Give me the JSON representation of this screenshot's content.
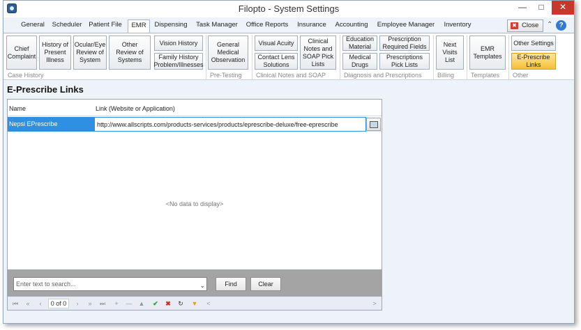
{
  "window": {
    "title": "Filopto - System Settings"
  },
  "tabs": [
    {
      "label": "General"
    },
    {
      "label": "Scheduler"
    },
    {
      "label": "Patient File"
    },
    {
      "label": "EMR"
    },
    {
      "label": "Dispensing"
    },
    {
      "label": "Task Manager"
    },
    {
      "label": "Office Reports"
    },
    {
      "label": "Insurance"
    },
    {
      "label": "Accounting"
    },
    {
      "label": "Employee Manager"
    },
    {
      "label": "Inventory"
    }
  ],
  "active_tab": "EMR",
  "close_button": {
    "label": "Close"
  },
  "ribbon": {
    "case_history": {
      "label": "Case History",
      "buttons": [
        "Chief Complaint",
        "History of Present Illness",
        "Ocular/Eye Review of System",
        "Other Review of Systems",
        "Vision History",
        "Family History Problem/Illnesses"
      ]
    },
    "pre_testing": {
      "label": "Pre-Testing",
      "buttons": [
        "General Medical Observation"
      ]
    },
    "clinical_notes": {
      "label": "Clinical Notes and SOAP",
      "buttons": [
        "Visual Acuity",
        "Contact Lens Solutions",
        "Clinical Notes and SOAP Pick Lists"
      ]
    },
    "diagnosis": {
      "label": "Diagnosis and Prescriptions",
      "buttons": [
        "Education Material",
        "Medical Drugs",
        "Prescription Required Fields",
        "Prescriptions Pick Lists"
      ]
    },
    "billing": {
      "label": "Billing",
      "buttons": [
        "Next Visits List"
      ]
    },
    "templates": {
      "label": "Templates",
      "buttons": [
        "EMR Templates"
      ]
    },
    "other": {
      "label": "Other",
      "buttons": [
        "Other Settings",
        "E-Prescribe Links"
      ]
    }
  },
  "page": {
    "title": "E-Prescribe Links"
  },
  "grid": {
    "columns": [
      "Name",
      "Link (Website or Application)"
    ],
    "rows": [
      {
        "name": "Nepsi EPrescribe",
        "link": "http://www.allscripts.com/products-services/products/eprescribe-deluxe/free-eprescribe"
      }
    ],
    "empty_text": "<No data to display>"
  },
  "search": {
    "placeholder": "Enter text to search...",
    "find_label": "Find",
    "clear_label": "Clear"
  },
  "navigator": {
    "pager_text": "0 of 0"
  },
  "colors": {
    "selection": "#2f8fe0",
    "highlight_button": "#f5bf38",
    "close_red": "#c7382c"
  }
}
